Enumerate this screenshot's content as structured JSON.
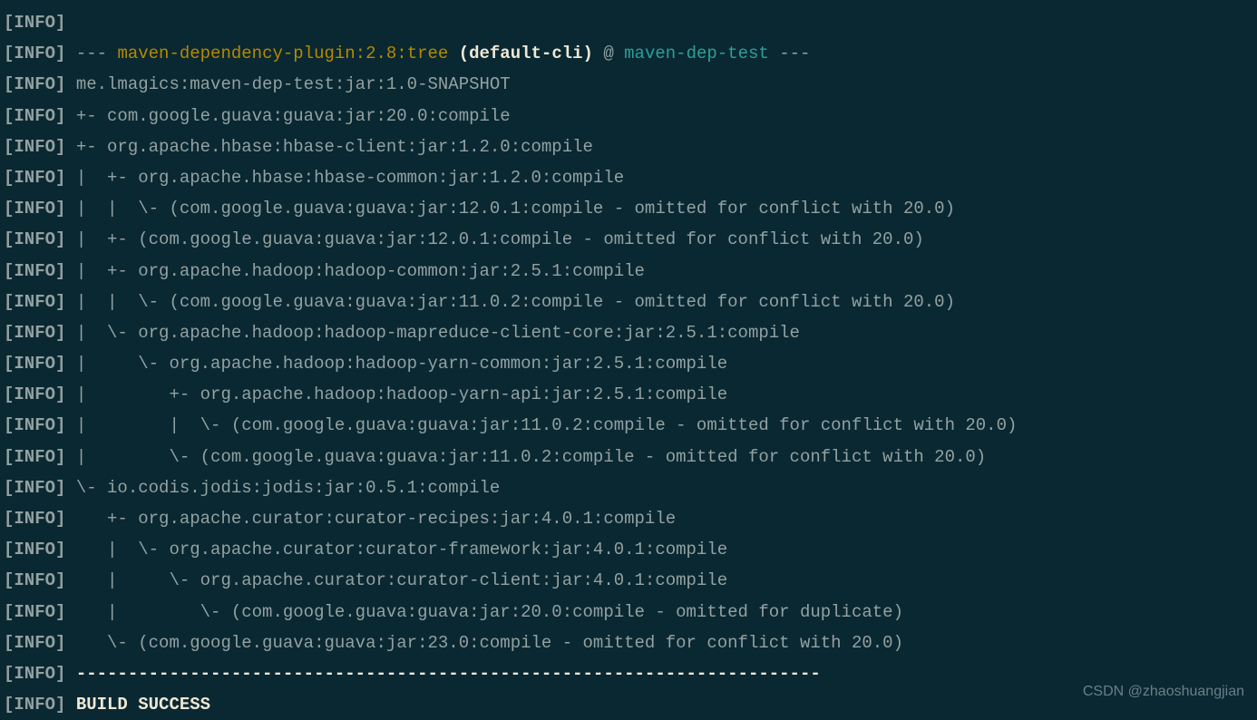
{
  "prefix": {
    "open": "[",
    "label": "INFO",
    "close": "]"
  },
  "lines": {
    "l0": "",
    "l1_dashes_pre": " --- ",
    "l1_plugin": "maven-dependency-plugin:2.8:tree",
    "l1_default": " (default-cli)",
    "l1_at": " @ ",
    "l1_project": "maven-dep-test",
    "l1_dashes_post": " ---",
    "l2": " me.lmagics:maven-dep-test:jar:1.0-SNAPSHOT",
    "l3": " +- com.google.guava:guava:jar:20.0:compile",
    "l4": " +- org.apache.hbase:hbase-client:jar:1.2.0:compile",
    "l5": " |  +- org.apache.hbase:hbase-common:jar:1.2.0:compile",
    "l6": " |  |  \\- (com.google.guava:guava:jar:12.0.1:compile - omitted for conflict with 20.0)",
    "l7": " |  +- (com.google.guava:guava:jar:12.0.1:compile - omitted for conflict with 20.0)",
    "l8": " |  +- org.apache.hadoop:hadoop-common:jar:2.5.1:compile",
    "l9": " |  |  \\- (com.google.guava:guava:jar:11.0.2:compile - omitted for conflict with 20.0)",
    "l10": " |  \\- org.apache.hadoop:hadoop-mapreduce-client-core:jar:2.5.1:compile",
    "l11": " |     \\- org.apache.hadoop:hadoop-yarn-common:jar:2.5.1:compile",
    "l12": " |        +- org.apache.hadoop:hadoop-yarn-api:jar:2.5.1:compile",
    "l13": " |        |  \\- (com.google.guava:guava:jar:11.0.2:compile - omitted for conflict with 20.0)",
    "l14": " |        \\- (com.google.guava:guava:jar:11.0.2:compile - omitted for conflict with 20.0)",
    "l15": " \\- io.codis.jodis:jodis:jar:0.5.1:compile",
    "l16": "    +- org.apache.curator:curator-recipes:jar:4.0.1:compile",
    "l17": "    |  \\- org.apache.curator:curator-framework:jar:4.0.1:compile",
    "l18": "    |     \\- org.apache.curator:curator-client:jar:4.0.1:compile",
    "l19": "    |        \\- (com.google.guava:guava:jar:20.0:compile - omitted for duplicate)",
    "l20": "    \\- (com.google.guava:guava:jar:23.0:compile - omitted for conflict with 20.0)",
    "l21": " ------------------------------------------------------------------------",
    "l22": " BUILD SUCCESS"
  },
  "watermark": "CSDN @zhaoshuangjian"
}
